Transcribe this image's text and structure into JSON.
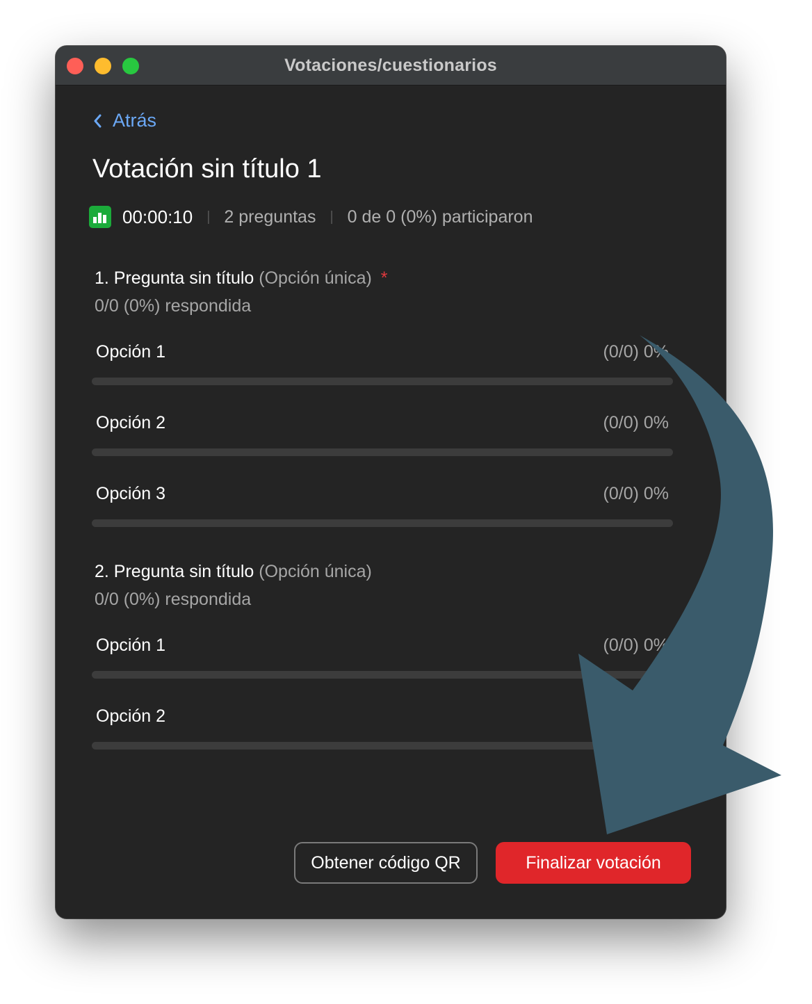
{
  "window": {
    "title": "Votaciones/cuestionarios"
  },
  "nav": {
    "back_label": "Atrás"
  },
  "poll": {
    "title": "Votación sin título 1",
    "timer": "00:00:10",
    "questions_count": "2 preguntas",
    "participation": "0 de 0 (0%) participaron"
  },
  "questions": [
    {
      "title": "1. Pregunta sin título",
      "type": "(Opción única)",
      "required_mark": "*",
      "answered": "0/0 (0%) respondida",
      "options": [
        {
          "label": "Opción 1",
          "value": "(0/0) 0%",
          "percent": 0
        },
        {
          "label": "Opción 2",
          "value": "(0/0) 0%",
          "percent": 0
        },
        {
          "label": "Opción 3",
          "value": "(0/0) 0%",
          "percent": 0
        }
      ]
    },
    {
      "title": "2. Pregunta sin título",
      "type": "(Opción única)",
      "answered": "0/0 (0%) respondida",
      "options": [
        {
          "label": "Opción 1",
          "value": "(0/0) 0%",
          "percent": 0
        },
        {
          "label": "Opción 2",
          "value": "(0/0) 0%",
          "percent": 0
        }
      ]
    }
  ],
  "actions": {
    "qr_label": "Obtener código QR",
    "end_label": "Finalizar votación"
  },
  "colors": {
    "accent_link": "#6ba8f5",
    "end_button": "#e0262a",
    "annotation_arrow": "#3a5b6b",
    "poll_icon": "#1bab3a"
  },
  "icons": [
    "chevron-left-icon",
    "bar-chart-icon",
    "annotation-arrow"
  ]
}
